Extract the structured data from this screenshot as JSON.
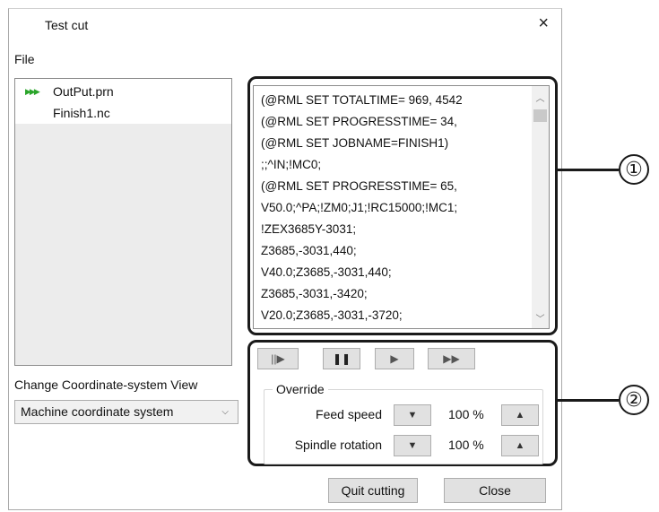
{
  "window": {
    "title": "Test cut",
    "close_icon": "×"
  },
  "file_section": {
    "label": "File",
    "items": [
      {
        "name": "OutPut.prn",
        "active": true,
        "marker_icon": "play-triple-arrow-icon"
      },
      {
        "name": "Finish1.nc",
        "active": false
      }
    ]
  },
  "coordinate_view": {
    "label": "Change Coordinate-system View",
    "selected": "Machine coordinate system"
  },
  "code_lines": [
    "(@RML SET TOTALTIME=        969,    4542",
    "(@RML SET PROGRESSTIME=         34,",
    "(@RML SET JOBNAME=FINISH1)",
    ";;^IN;!MC0;",
    "(@RML SET PROGRESSTIME=         65,",
    "V50.0;^PA;!ZM0;J1;!RC15000;!MC1;",
    "!ZEX3685Y-3031;",
    "Z3685,-3031,440;",
    "V40.0;Z3685,-3031,440;",
    "Z3685,-3031,-3420;",
    "V20.0;Z3685,-3031,-3720;"
  ],
  "playback": {
    "step_icon": "step-play-icon",
    "pause_icon": "pause-icon",
    "play_icon": "play-icon",
    "fast_forward_icon": "fast-forward-icon"
  },
  "override": {
    "label": "Override",
    "feed_speed": {
      "label": "Feed speed",
      "value": "100 %"
    },
    "spindle_rotation": {
      "label": "Spindle rotation",
      "value": "100 %"
    }
  },
  "buttons": {
    "quit": "Quit cutting",
    "close": "Close"
  },
  "annotations": {
    "callout_1": "①",
    "callout_2": "②"
  },
  "colors": {
    "active_arrow": "#2aa52a",
    "annotation": "#1a1a1a",
    "button_face": "#e1e1e1"
  }
}
